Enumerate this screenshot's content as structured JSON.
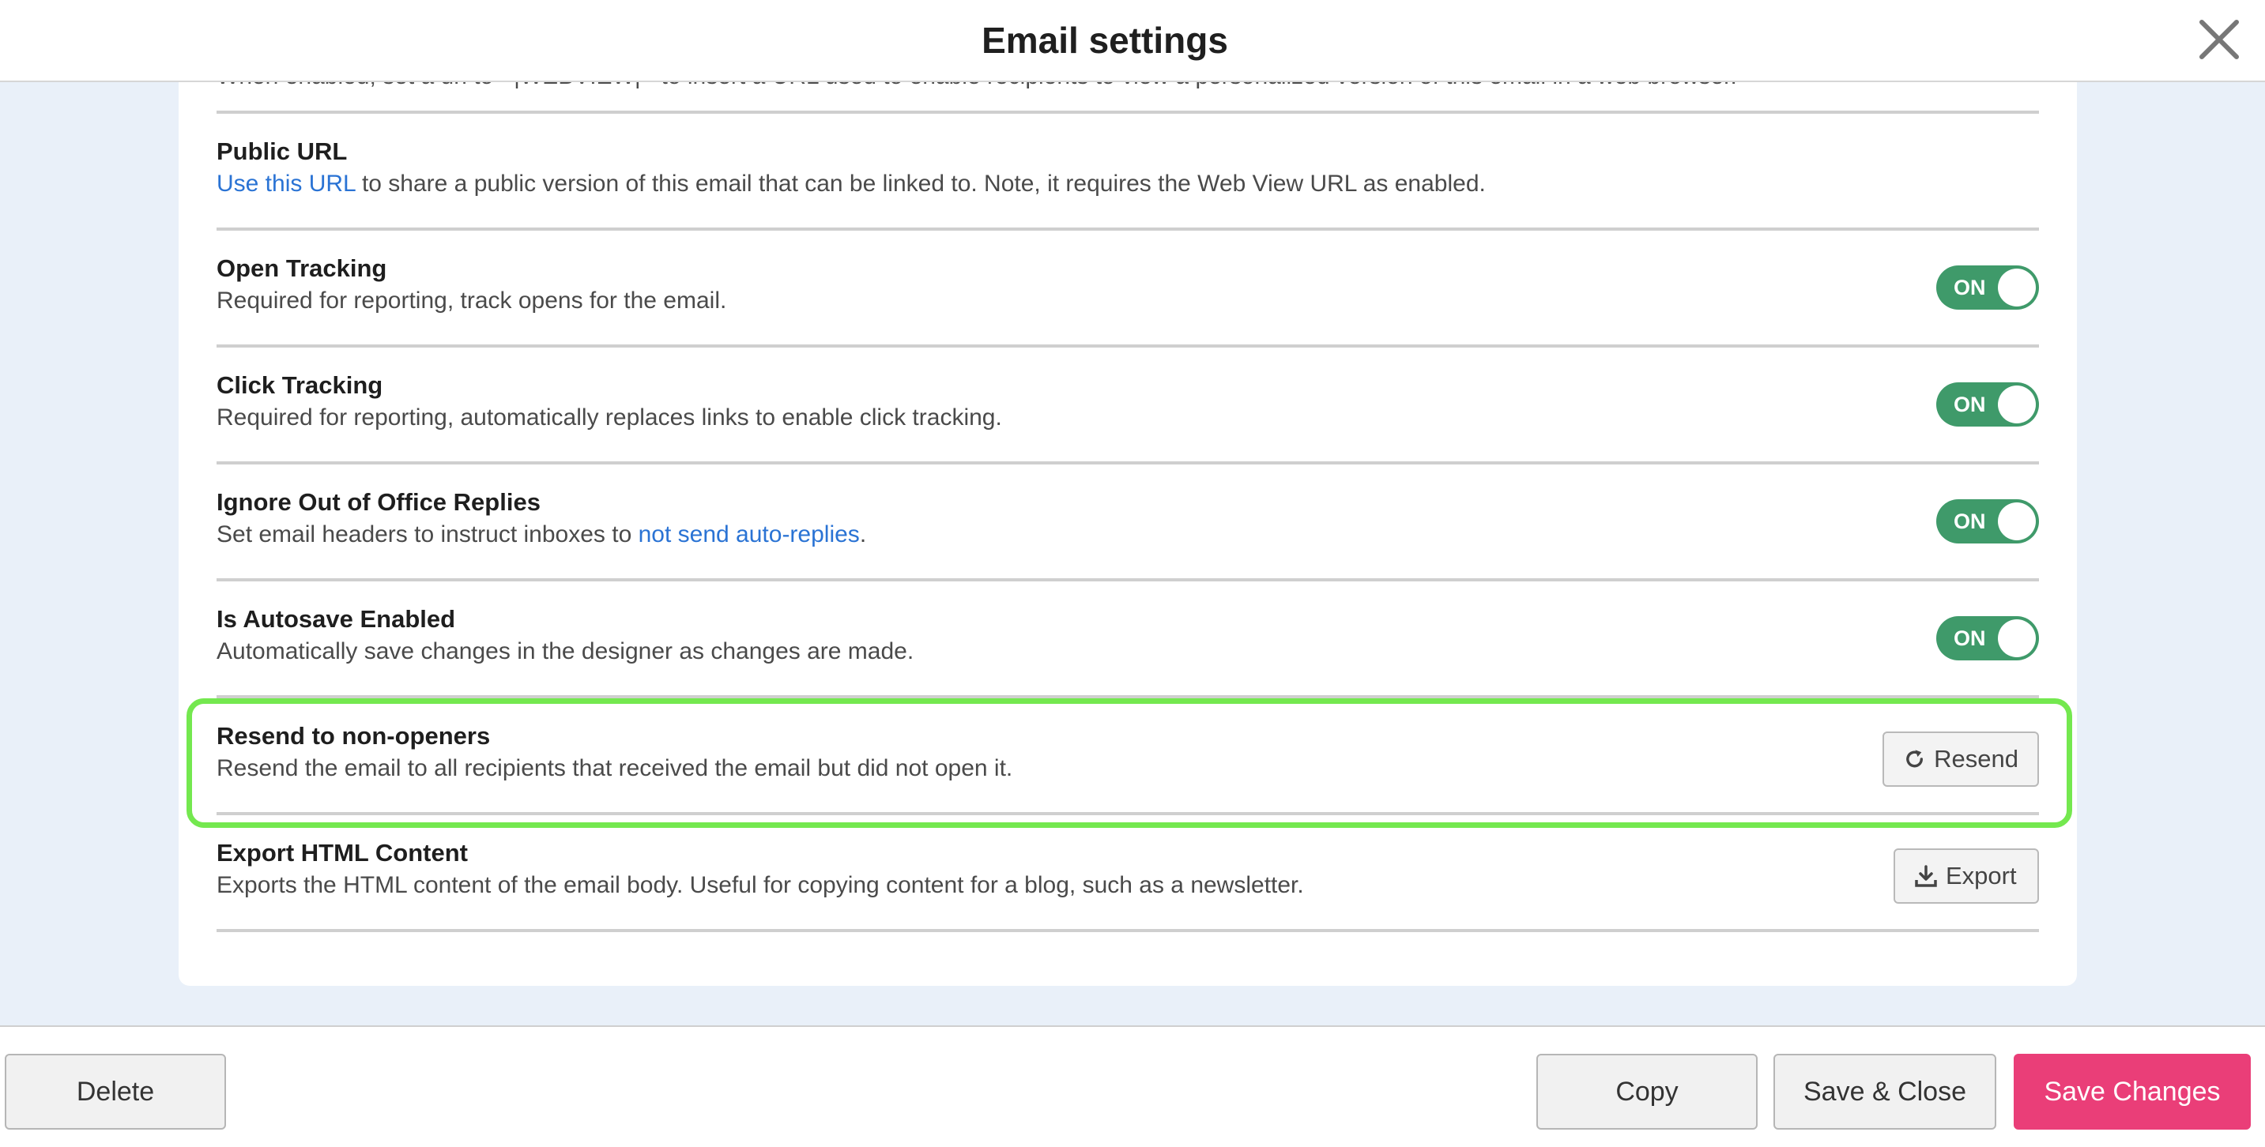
{
  "dialog": {
    "title": "Email settings"
  },
  "settings": {
    "webview_cut": {
      "desc": "When enabled, set a url to +|WEBVIEW|+ to insert a URL used to enable recipients to view a personalized version of this email in a web browser."
    },
    "public_url": {
      "title": "Public URL",
      "link": "Use this URL",
      "desc_rest": " to share a public version of this email that can be linked to. Note, it requires the Web View URL as enabled."
    },
    "open_tracking": {
      "title": "Open Tracking",
      "desc": "Required for reporting, track opens for the email.",
      "toggle": "ON"
    },
    "click_tracking": {
      "title": "Click Tracking",
      "desc": "Required for reporting, automatically replaces links to enable click tracking.",
      "toggle": "ON"
    },
    "ignore_ooo": {
      "title": "Ignore Out of Office Replies",
      "desc_start": "Set email headers to instruct inboxes to ",
      "link": "not send auto-replies",
      "desc_end": ".",
      "toggle": "ON"
    },
    "autosave": {
      "title": "Is Autosave Enabled",
      "desc": "Automatically save changes in the designer as changes are made.",
      "toggle": "ON"
    },
    "resend": {
      "title": "Resend to non-openers",
      "desc": "Resend the email to all recipients that received the email but did not open it.",
      "button": "Resend"
    },
    "export": {
      "title": "Export HTML Content",
      "desc": "Exports the HTML content of the email body. Useful for copying content for a blog, such as a newsletter.",
      "button": "Export"
    }
  },
  "footer": {
    "delete": "Delete",
    "copy": "Copy",
    "save_close": "Save & Close",
    "save_changes": "Save Changes"
  },
  "colors": {
    "toggle_on": "#3f9a6a",
    "link": "#2a73d4",
    "highlight": "#74e84f",
    "primary": "#ea3e78"
  }
}
